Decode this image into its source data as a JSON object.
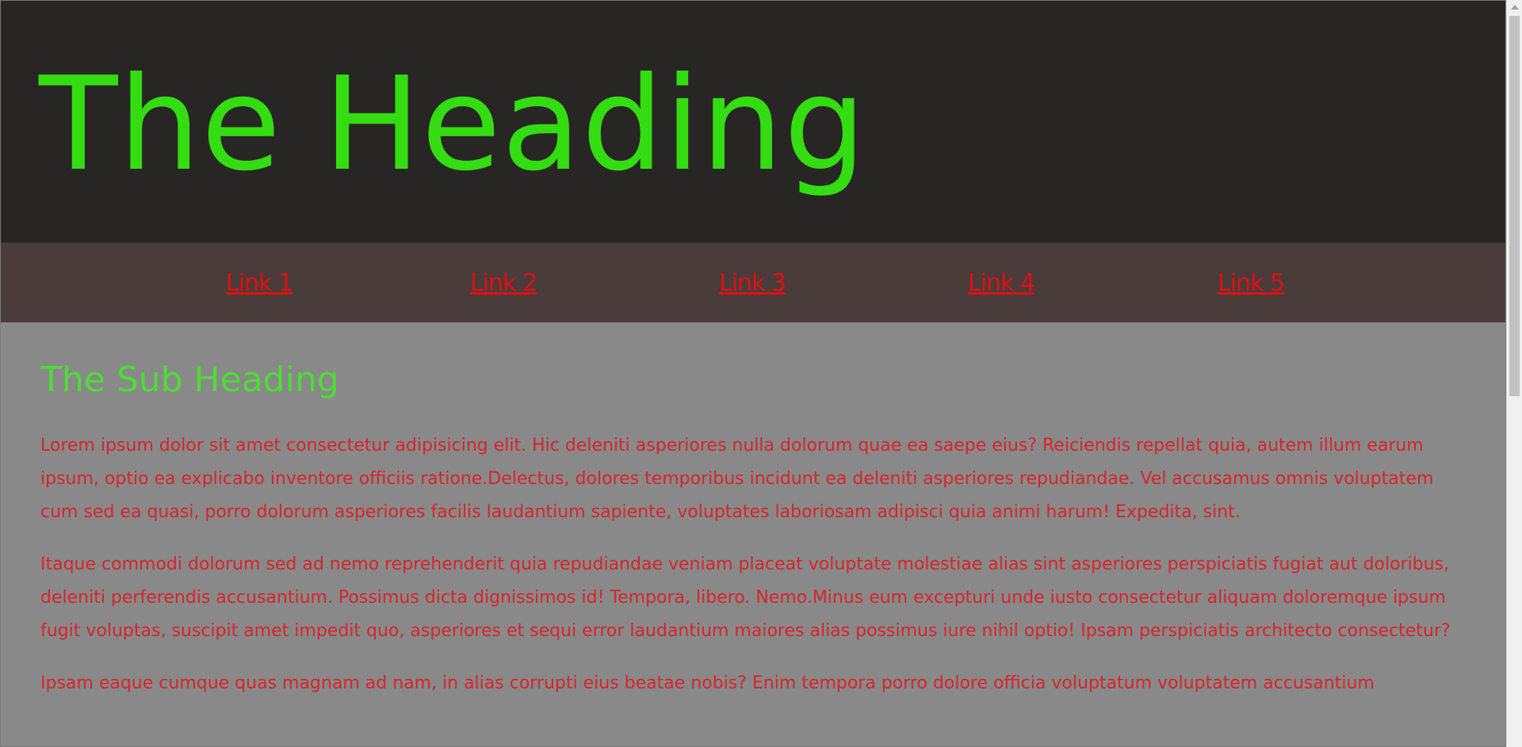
{
  "header": {
    "title": "The Heading"
  },
  "nav": {
    "links": [
      {
        "label": "Link 1"
      },
      {
        "label": "Link 2"
      },
      {
        "label": "Link 3"
      },
      {
        "label": "Link 4"
      },
      {
        "label": "Link 5"
      }
    ]
  },
  "main": {
    "sub_heading": "The Sub Heading",
    "paragraphs": [
      "Lorem ipsum dolor sit amet consectetur adipisicing elit. Hic deleniti asperiores nulla dolorum quae ea saepe eius? Reiciendis repellat quia, autem illum earum ipsum, optio ea explicabo inventore officiis ratione.Delectus, dolores temporibus incidunt ea deleniti asperiores repudiandae. Vel accusamus omnis voluptatem cum sed ea quasi, porro dolorum asperiores facilis laudantium sapiente, voluptates laboriosam adipisci quia animi harum! Expedita, sint.",
      "Itaque commodi dolorum sed ad nemo reprehenderit quia repudiandae veniam placeat voluptate molestiae alias sint asperiores perspiciatis fugiat aut doloribus, deleniti perferendis accusantium. Possimus dicta dignissimos id! Tempora, libero. Nemo.Minus eum excepturi unde iusto consectetur aliquam doloremque ipsum fugit voluptas, suscipit amet impedit quo, asperiores et sequi error laudantium maiores alias possimus iure nihil optio! Ipsam perspiciatis architecto consectetur?",
      "Ipsam eaque cumque quas magnam ad nam, in alias corrupti eius beatae nobis? Enim tempora porro dolore officia voluptatum voluptatem accusantium"
    ]
  },
  "colors": {
    "header_bg": "#282624",
    "heading_green": "#33dd11",
    "nav_bg": "#4a3c3b",
    "link_red": "#e01010",
    "content_bg": "#898989",
    "subheading_green": "#4ddc35",
    "text_red": "#d8242a"
  }
}
